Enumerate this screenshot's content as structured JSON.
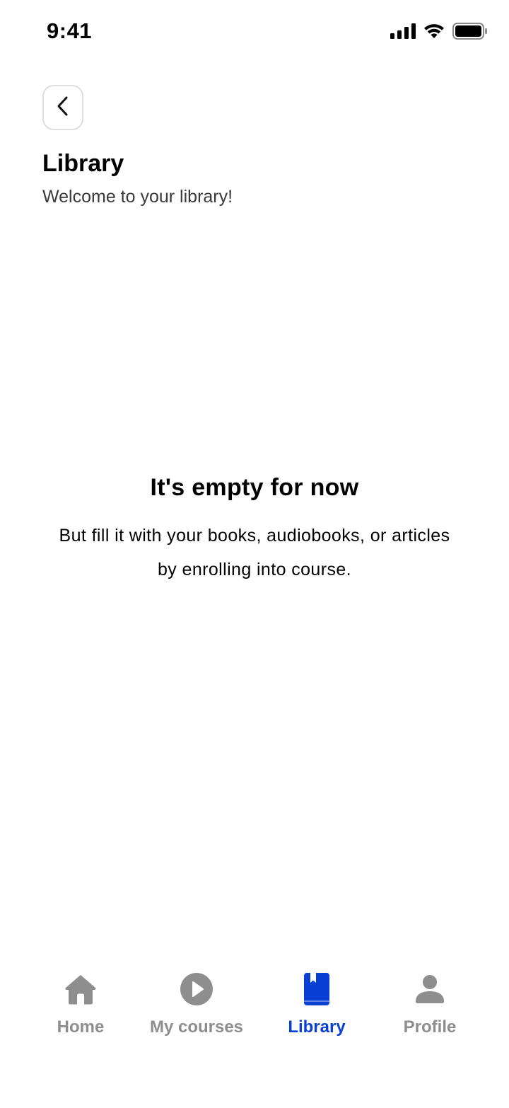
{
  "status_bar": {
    "time": "9:41",
    "icons": [
      "signal-icon",
      "wifi-icon",
      "battery-icon"
    ]
  },
  "header": {
    "back_icon": "chevron-left-icon",
    "title": "Library",
    "subtitle": "Welcome to your library!"
  },
  "empty_state": {
    "title": "It's empty for now",
    "message": "But fill it with your books, audiobooks, or articles by enrolling into course."
  },
  "tab_bar": {
    "active_color": "#0a3fd6",
    "inactive_color": "#8e8e8e",
    "tabs": [
      {
        "label": "Home",
        "icon": "home-icon",
        "active": false
      },
      {
        "label": "My courses",
        "icon": "play-circle-icon",
        "active": false
      },
      {
        "label": "Library",
        "icon": "bookmark-book-icon",
        "active": true
      },
      {
        "label": "Profile",
        "icon": "user-icon",
        "active": false
      }
    ]
  }
}
